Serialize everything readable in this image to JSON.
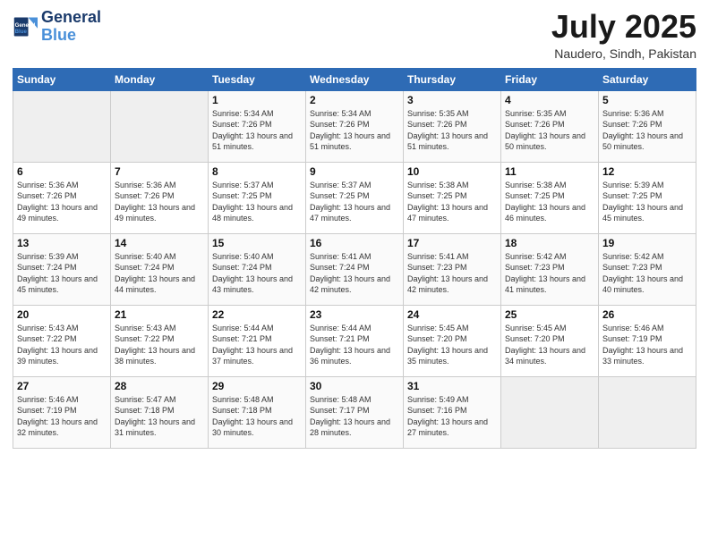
{
  "header": {
    "logo_line1": "General",
    "logo_line2": "Blue",
    "title": "July 2025",
    "subtitle": "Naudero, Sindh, Pakistan"
  },
  "weekdays": [
    "Sunday",
    "Monday",
    "Tuesday",
    "Wednesday",
    "Thursday",
    "Friday",
    "Saturday"
  ],
  "weeks": [
    [
      {
        "day": "",
        "empty": true
      },
      {
        "day": "",
        "empty": true
      },
      {
        "day": "1",
        "sunrise": "5:34 AM",
        "sunset": "7:26 PM",
        "daylight": "13 hours and 51 minutes."
      },
      {
        "day": "2",
        "sunrise": "5:34 AM",
        "sunset": "7:26 PM",
        "daylight": "13 hours and 51 minutes."
      },
      {
        "day": "3",
        "sunrise": "5:35 AM",
        "sunset": "7:26 PM",
        "daylight": "13 hours and 51 minutes."
      },
      {
        "day": "4",
        "sunrise": "5:35 AM",
        "sunset": "7:26 PM",
        "daylight": "13 hours and 50 minutes."
      },
      {
        "day": "5",
        "sunrise": "5:36 AM",
        "sunset": "7:26 PM",
        "daylight": "13 hours and 50 minutes."
      }
    ],
    [
      {
        "day": "6",
        "sunrise": "5:36 AM",
        "sunset": "7:26 PM",
        "daylight": "13 hours and 49 minutes."
      },
      {
        "day": "7",
        "sunrise": "5:36 AM",
        "sunset": "7:26 PM",
        "daylight": "13 hours and 49 minutes."
      },
      {
        "day": "8",
        "sunrise": "5:37 AM",
        "sunset": "7:25 PM",
        "daylight": "13 hours and 48 minutes."
      },
      {
        "day": "9",
        "sunrise": "5:37 AM",
        "sunset": "7:25 PM",
        "daylight": "13 hours and 47 minutes."
      },
      {
        "day": "10",
        "sunrise": "5:38 AM",
        "sunset": "7:25 PM",
        "daylight": "13 hours and 47 minutes."
      },
      {
        "day": "11",
        "sunrise": "5:38 AM",
        "sunset": "7:25 PM",
        "daylight": "13 hours and 46 minutes."
      },
      {
        "day": "12",
        "sunrise": "5:39 AM",
        "sunset": "7:25 PM",
        "daylight": "13 hours and 45 minutes."
      }
    ],
    [
      {
        "day": "13",
        "sunrise": "5:39 AM",
        "sunset": "7:24 PM",
        "daylight": "13 hours and 45 minutes."
      },
      {
        "day": "14",
        "sunrise": "5:40 AM",
        "sunset": "7:24 PM",
        "daylight": "13 hours and 44 minutes."
      },
      {
        "day": "15",
        "sunrise": "5:40 AM",
        "sunset": "7:24 PM",
        "daylight": "13 hours and 43 minutes."
      },
      {
        "day": "16",
        "sunrise": "5:41 AM",
        "sunset": "7:24 PM",
        "daylight": "13 hours and 42 minutes."
      },
      {
        "day": "17",
        "sunrise": "5:41 AM",
        "sunset": "7:23 PM",
        "daylight": "13 hours and 42 minutes."
      },
      {
        "day": "18",
        "sunrise": "5:42 AM",
        "sunset": "7:23 PM",
        "daylight": "13 hours and 41 minutes."
      },
      {
        "day": "19",
        "sunrise": "5:42 AM",
        "sunset": "7:23 PM",
        "daylight": "13 hours and 40 minutes."
      }
    ],
    [
      {
        "day": "20",
        "sunrise": "5:43 AM",
        "sunset": "7:22 PM",
        "daylight": "13 hours and 39 minutes."
      },
      {
        "day": "21",
        "sunrise": "5:43 AM",
        "sunset": "7:22 PM",
        "daylight": "13 hours and 38 minutes."
      },
      {
        "day": "22",
        "sunrise": "5:44 AM",
        "sunset": "7:21 PM",
        "daylight": "13 hours and 37 minutes."
      },
      {
        "day": "23",
        "sunrise": "5:44 AM",
        "sunset": "7:21 PM",
        "daylight": "13 hours and 36 minutes."
      },
      {
        "day": "24",
        "sunrise": "5:45 AM",
        "sunset": "7:20 PM",
        "daylight": "13 hours and 35 minutes."
      },
      {
        "day": "25",
        "sunrise": "5:45 AM",
        "sunset": "7:20 PM",
        "daylight": "13 hours and 34 minutes."
      },
      {
        "day": "26",
        "sunrise": "5:46 AM",
        "sunset": "7:19 PM",
        "daylight": "13 hours and 33 minutes."
      }
    ],
    [
      {
        "day": "27",
        "sunrise": "5:46 AM",
        "sunset": "7:19 PM",
        "daylight": "13 hours and 32 minutes."
      },
      {
        "day": "28",
        "sunrise": "5:47 AM",
        "sunset": "7:18 PM",
        "daylight": "13 hours and 31 minutes."
      },
      {
        "day": "29",
        "sunrise": "5:48 AM",
        "sunset": "7:18 PM",
        "daylight": "13 hours and 30 minutes."
      },
      {
        "day": "30",
        "sunrise": "5:48 AM",
        "sunset": "7:17 PM",
        "daylight": "13 hours and 28 minutes."
      },
      {
        "day": "31",
        "sunrise": "5:49 AM",
        "sunset": "7:16 PM",
        "daylight": "13 hours and 27 minutes."
      },
      {
        "day": "",
        "empty": true
      },
      {
        "day": "",
        "empty": true
      }
    ]
  ]
}
